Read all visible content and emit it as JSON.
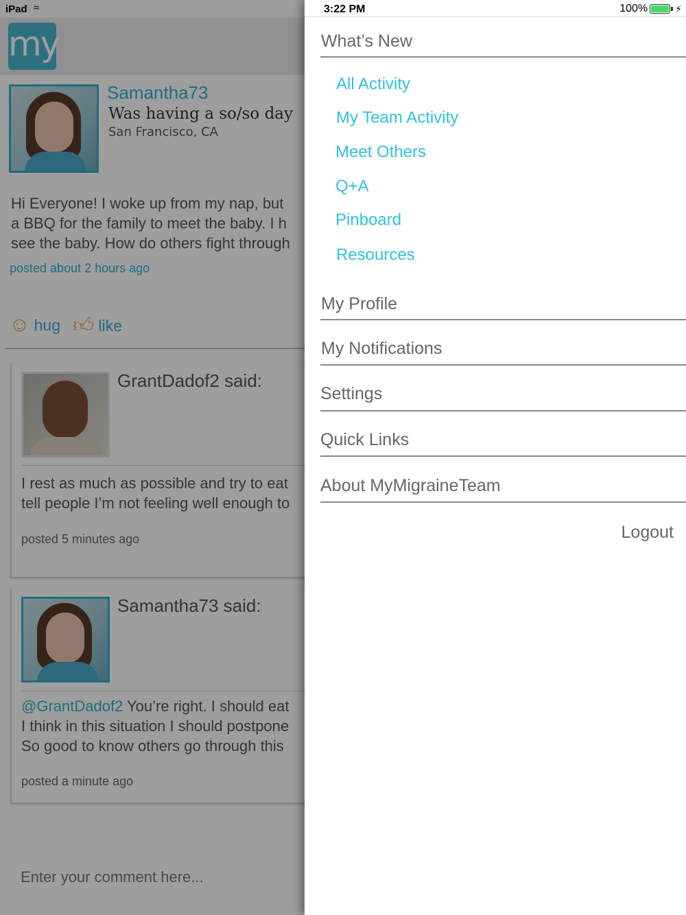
{
  "status_bar": {
    "device": "iPad",
    "time": "3:22 PM",
    "battery": "100%"
  },
  "app": {
    "logo_text": "my",
    "post": {
      "username": "Samantha73",
      "mood": "Was having a so/so day",
      "location": "San Francisco, CA",
      "body_lines": [
        "Hi Everyone! I woke up from my nap, but",
        "a BBQ for the family to meet the baby.  I h",
        "see the baby.  How do others fight through"
      ],
      "time": "posted about 2 hours ago",
      "hug_label": "hug",
      "like_label": "like"
    },
    "comments": [
      {
        "author": "GrantDadof2 said:",
        "mention": "",
        "lines": [
          "I rest as much as possible and try to eat",
          "tell people I’m not feeling well enough to"
        ],
        "time": "posted 5 minutes ago"
      },
      {
        "author": "Samantha73 said:",
        "mention": "@GrantDadof2",
        "first_line_rest": " You’re right. I should eat",
        "lines": [
          "I think in this situation I should postpone",
          "So good to know others go through this"
        ],
        "time": "posted a  minute ago"
      }
    ],
    "comment_placeholder": "Enter your comment here..."
  },
  "drawer": {
    "whats_new": "What’s New",
    "items": [
      "All Activity",
      "My Team Activity",
      "Meet Others",
      "Q+A",
      "Pinboard",
      "Resources"
    ],
    "sections": [
      "My Profile",
      "My Notifications",
      "Settings",
      "Quick Links",
      "About MyMigraineTeam"
    ],
    "logout": "Logout"
  },
  "colors": {
    "accent": "#2fc2dc",
    "link": "#2fb0cc",
    "logo_bg": "#49b7cf",
    "section_text": "#666666",
    "battery": "#4cd964"
  }
}
